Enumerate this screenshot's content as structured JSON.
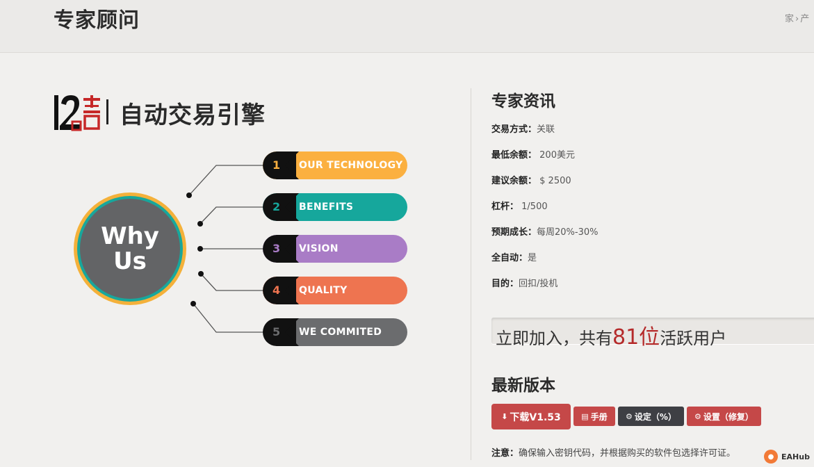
{
  "header": {
    "title": "专家顾问",
    "breadcrumb": [
      "家",
      "产"
    ]
  },
  "product": {
    "logo_text": "12吉",
    "title": "自动交易引擎"
  },
  "why_us": {
    "center": [
      "Why",
      "Us"
    ],
    "items": [
      {
        "num": "1",
        "label": "OUR TECHNOLOGY",
        "color": "#fbb040"
      },
      {
        "num": "2",
        "label": "BENEFITS",
        "color": "#16a79c"
      },
      {
        "num": "3",
        "label": "VISION",
        "color": "#a97cc6"
      },
      {
        "num": "4",
        "label": "QUALITY",
        "color": "#ee7450"
      },
      {
        "num": "5",
        "label": "WE COMMITED",
        "color": "#6b6c6e"
      }
    ]
  },
  "info": {
    "title": "专家资讯",
    "rows": [
      {
        "key": "交易方式：",
        "value": "关联"
      },
      {
        "key": "最低余额：",
        "value": " 200美元"
      },
      {
        "key": "建议余额：",
        "value": " $ 2500"
      },
      {
        "key": "杠杆：",
        "value": " 1/500"
      },
      {
        "key": "预期成长：",
        "value": "每周20%-30%"
      },
      {
        "key": "全自动：",
        "value": "是"
      },
      {
        "key": "目的：",
        "value": "回扣/投机"
      }
    ]
  },
  "join": {
    "prefix": "立即加入，共有",
    "count": "81位",
    "suffix": "活跃用户"
  },
  "latest": {
    "title": "最新版本",
    "download_label": "下载V1.53",
    "manual_label": "手册",
    "settings_label": "设定（%）",
    "settings_fixed_label": "设置（修复）"
  },
  "note": {
    "key": "注意：",
    "text": "确保输入密钥代码，并根据购买的软件包选择许可证。"
  },
  "watermark": {
    "text": "EAHub"
  },
  "colors": {
    "accent_red": "#c54848",
    "dark_button": "#3e3f44",
    "count_red": "#b52a2a"
  }
}
